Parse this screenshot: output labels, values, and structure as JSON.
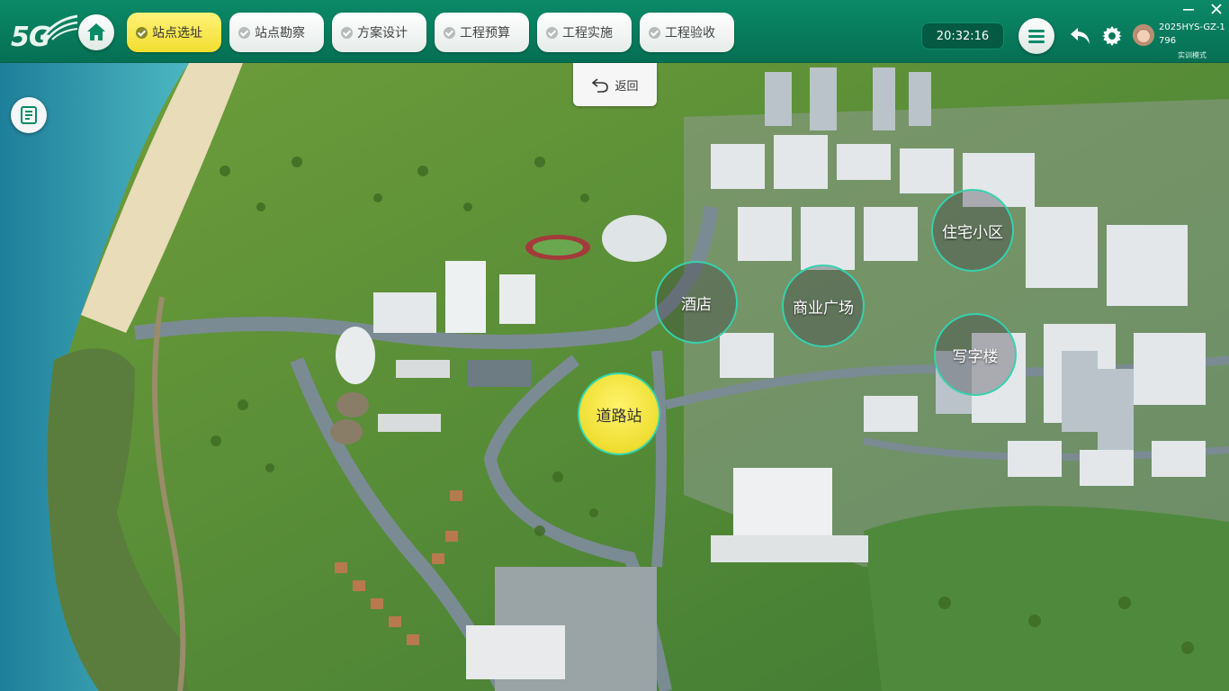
{
  "header": {
    "logo_text": "5G",
    "nav_items": [
      {
        "label": "站点选址",
        "active": true
      },
      {
        "label": "站点勘察",
        "active": false
      },
      {
        "label": "方案设计",
        "active": false
      },
      {
        "label": "工程预算",
        "active": false
      },
      {
        "label": "工程实施",
        "active": false
      },
      {
        "label": "工程验收",
        "active": false
      }
    ],
    "clock": "20:32:16",
    "user": {
      "name": "2025HYS-GZ-1796",
      "mode": "实训模式"
    },
    "icons": {
      "home": "home-icon",
      "menu": "menu-icon",
      "back": "back-arrow-icon",
      "settings": "gear-icon",
      "minimize": "minimize-icon",
      "close": "close-icon"
    }
  },
  "map": {
    "return_label": "返回",
    "doc_icon": "document-icon",
    "sites": [
      {
        "label": "道路站",
        "selected": true
      },
      {
        "label": "酒店",
        "selected": false
      },
      {
        "label": "商业广场",
        "selected": false
      },
      {
        "label": "住宅小区",
        "selected": false
      },
      {
        "label": "写字楼",
        "selected": false
      }
    ]
  },
  "colors": {
    "accent_green": "#0b8a68",
    "active_yellow": "#f2de2e",
    "ring_teal": "#36d1ae"
  }
}
